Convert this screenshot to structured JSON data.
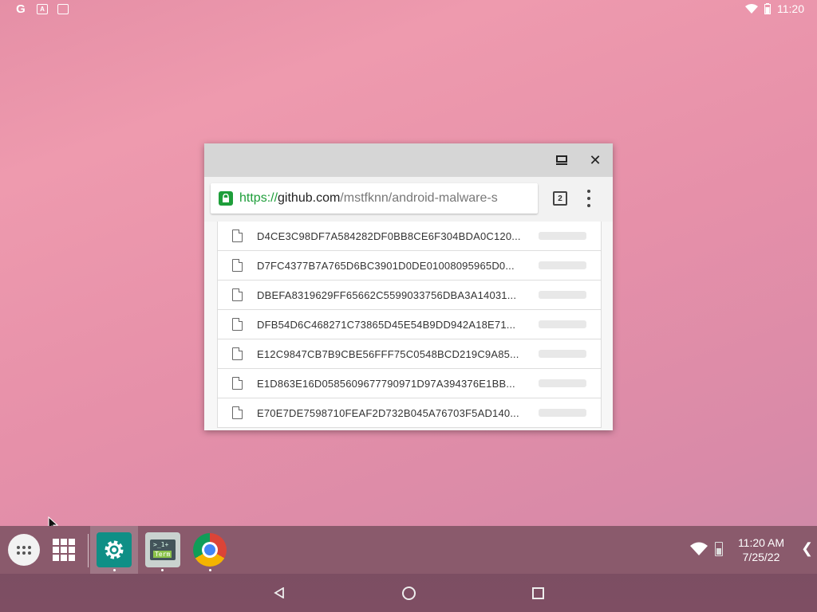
{
  "statusbar": {
    "left_icons": [
      "google-icon",
      "text-icon",
      "photo-icon"
    ],
    "left_glyphs": {
      "google": "G",
      "text": "A",
      "photo": "▭"
    },
    "time": "11:20"
  },
  "browser": {
    "url_scheme": "https://",
    "url_host": "github.com",
    "url_path": "/mstfknn/android-malware-s",
    "tab_count": "2",
    "files": [
      "D4CE3C98DF7A584282DF0BB8CE6F304BDA0C120...",
      "D7FC4377B7A765D6BC3901D0DE01008095965D0...",
      "DBEFA8319629FF65662C5599033756DBA3A14031...",
      "DFB54D6C468271C73865D45E54B9DD942A18E71...",
      "E12C9847CB7B9CBE56FFF75C0548BCD219C9A85...",
      "E1D863E16D0585609677790971D97A394376E1BB...",
      "E70E7DE7598710FEAF2D732B045A76703F5AD140..."
    ]
  },
  "taskbar": {
    "apps": [
      "Settings",
      "Term",
      "Chrome"
    ],
    "term_text_top": ">_1+",
    "term_text_bottom": "Term",
    "clock_time": "11:20 AM",
    "clock_date": "7/25/22",
    "arrow": "❮"
  }
}
